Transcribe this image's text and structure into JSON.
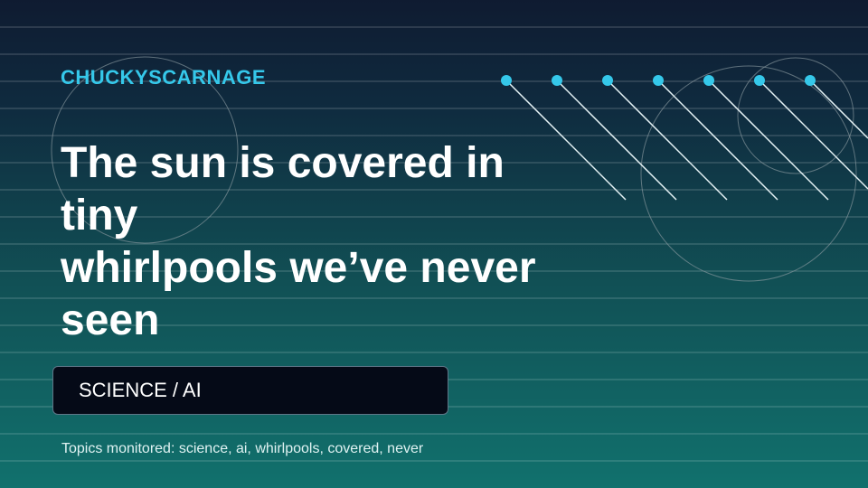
{
  "brand": "CHUCKYSCARNAGE",
  "headline": {
    "line1": "The sun is covered in",
    "line2": "tiny",
    "line3": "whirlpools we’ve never",
    "line4": "seen"
  },
  "category": "SCIENCE / AI",
  "topics": "Topics monitored: science, ai, whirlpools, covered, never",
  "colors": {
    "accent": "#35c8ea",
    "background_top": "#0f1b31",
    "background_bottom": "#11716d",
    "tag_background": "#050a17"
  }
}
